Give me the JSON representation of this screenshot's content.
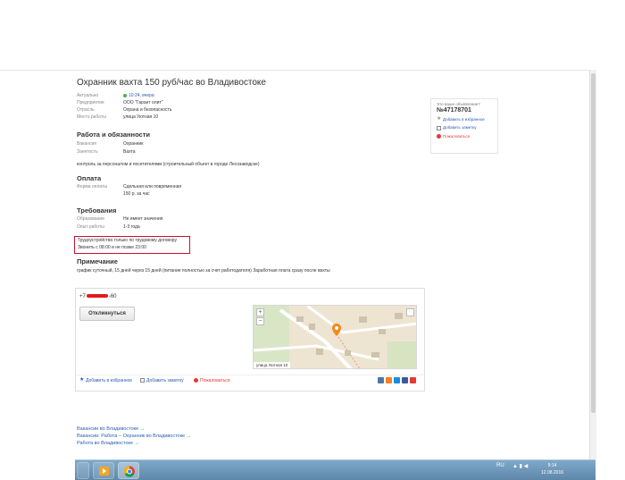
{
  "listing": {
    "title": "Охранник вахта 150 руб/час во Владивостоке",
    "meta": [
      {
        "key": "Актуально",
        "value": "10:24, вчера"
      },
      {
        "key": "Предприятие",
        "value": "ООО \"Гарант олит\""
      },
      {
        "key": "Отрасль",
        "value": "Охрана и безопасность"
      },
      {
        "key": "Место работы",
        "value": "улица Уютная 10"
      }
    ],
    "duties": {
      "heading": "Работа и обязанности",
      "rows": [
        {
          "key": "Вакансия",
          "value": "Охранник"
        },
        {
          "key": "Занятость",
          "value": "Вахта"
        }
      ],
      "description": "контроль за персоналом и посетителями (строительный объект в городе Лесозаводске)"
    },
    "pay": {
      "heading": "Оплата",
      "rows": [
        {
          "key": "Форма оплаты",
          "value": "Сдельная или повременная"
        },
        {
          "key": "",
          "value": "150 р. за час"
        }
      ]
    },
    "requirements": {
      "heading": "Требования",
      "rows": [
        {
          "key": "Образование",
          "value": "Не имеет значения"
        },
        {
          "key": "Опыт работы",
          "value": "1-3 года"
        }
      ],
      "note_line1": "Трудоустройство только по трудовому договору",
      "note_line2": "Звонить с 08:00 и не позже 23:00"
    },
    "remark": {
      "heading": "Примечание",
      "text": "график суточный, 15 дней через 15 дней (питание полностью за счет работодателя) Заработная плата сразу после вахты"
    }
  },
  "contact": {
    "phone_start": "+7",
    "phone_end": "-60",
    "respond_label": "Откликнуться",
    "map_label": "улица Уютная 10",
    "zoom_in": "+",
    "zoom_out": "−"
  },
  "actions": {
    "favorite": "Добавить в избранное",
    "note": "Добавить заметку",
    "complain": "Пожаловаться"
  },
  "sidebar": {
    "question": "Это ваше объявление?",
    "number": "№47178701",
    "favorite": "Добавить в избранное",
    "note": "Добавить заметку",
    "complain": "Пожаловаться"
  },
  "bottom_links": [
    "Вакансии во Владивостоке →",
    "Вакансии: Работа – Охранник во Владивостоке →",
    "Работа во Владивостоке →"
  ],
  "taskbar": {
    "lang": "RU",
    "time": "9:14",
    "date": "12.08.2016"
  },
  "colors": {
    "link": "#2a5db0",
    "highlight_box": "#c8102e",
    "status_green": "#4caf50"
  }
}
